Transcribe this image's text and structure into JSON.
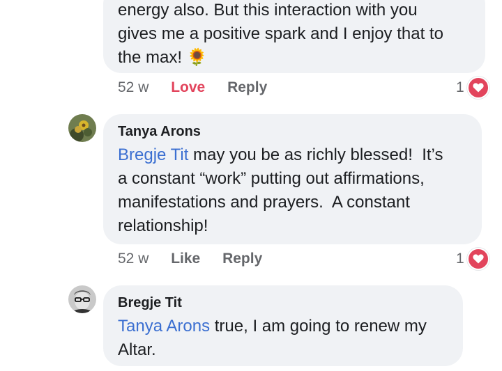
{
  "comments": [
    {
      "author": "",
      "text": "energy also. But this interaction with you\ngives me a positive spark and I enjoy that to\nthe max! ",
      "emoji": "🌻",
      "time": "52 w",
      "like_label": "Love",
      "reply_label": "Reply",
      "reaction_count": "1",
      "reaction_icon": "heart-icon"
    },
    {
      "author": "Tanya Arons",
      "mention": "Bregje Tit",
      "text": " may you be as richly blessed!  It’s\na constant “work” putting out affirmations,\nmanifestations and prayers.  A constant\nrelationship!",
      "time": "52 w",
      "like_label": "Like",
      "reply_label": "Reply",
      "reaction_count": "1",
      "reaction_icon": "heart-icon"
    },
    {
      "author": "Bregje Tit",
      "mention": "Tanya Arons",
      "text": " true, I am going to renew my\nAltar."
    }
  ],
  "colors": {
    "bubble": "#f0f2f5",
    "mention": "#3b6fd1",
    "love": "#e2445c",
    "meta": "#65676b"
  }
}
